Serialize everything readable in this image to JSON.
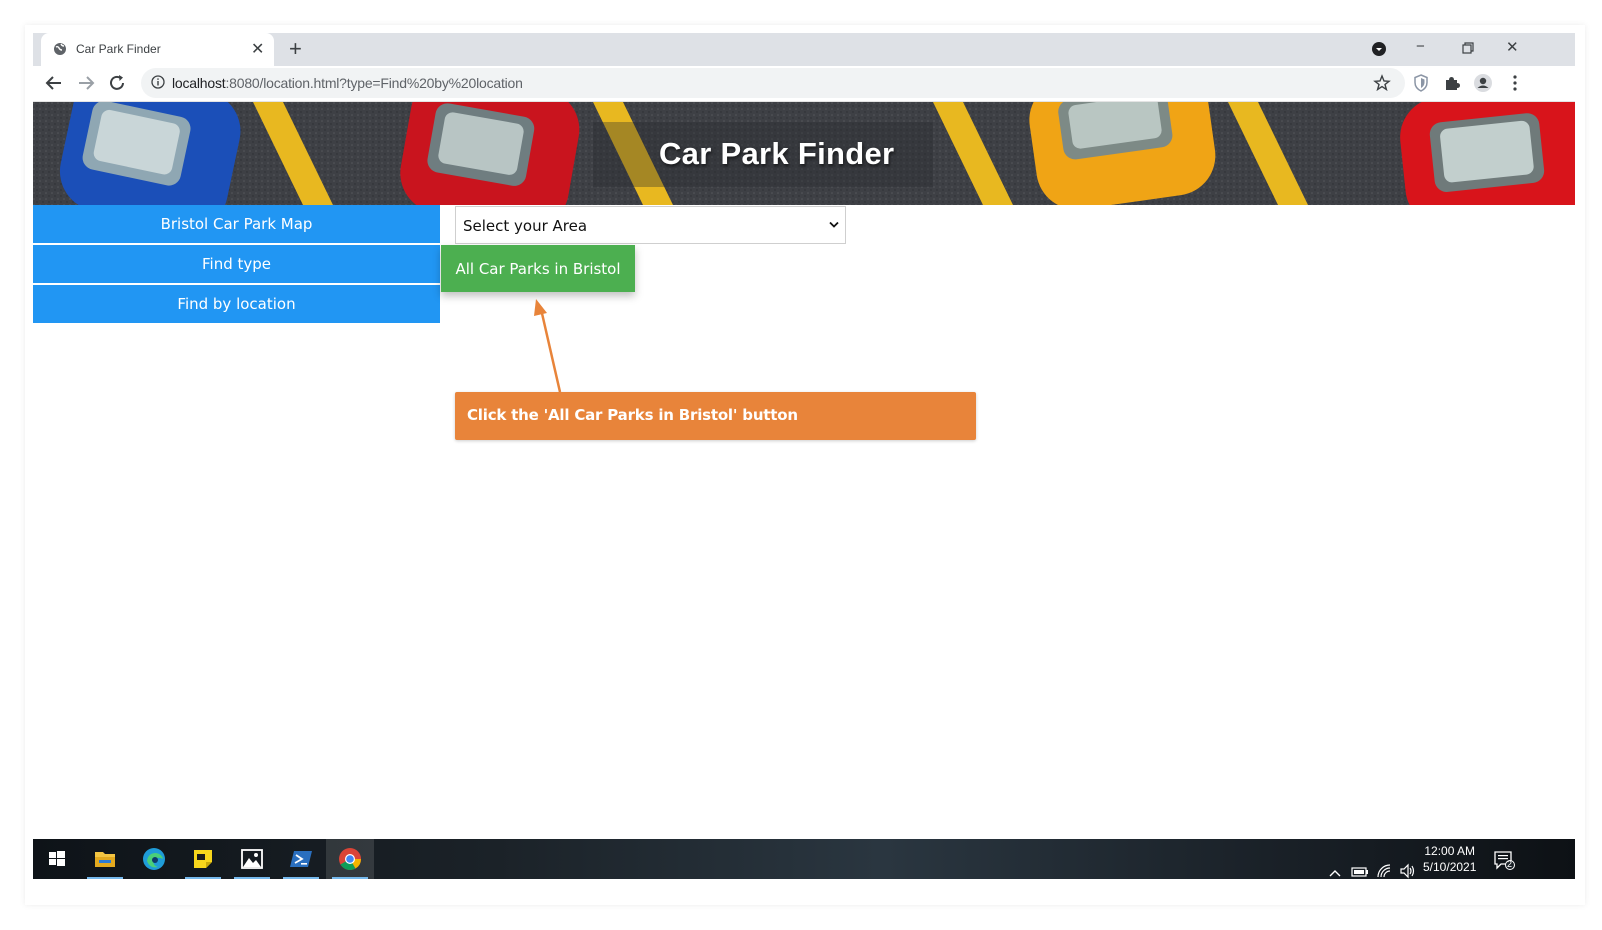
{
  "browser": {
    "tab_title": "Car Park Finder",
    "url_host": "localhost",
    "url_rest": ":8080/location.html?type=Find%20by%20location"
  },
  "page": {
    "banner_title": "Car Park Finder",
    "sidebar": [
      {
        "label": "Bristol Car Park Map"
      },
      {
        "label": "Find type"
      },
      {
        "label": "Find by location"
      }
    ],
    "area_select": {
      "selected": "Select your Area"
    },
    "all_car_parks_button": "All Car Parks in Bristol"
  },
  "annotation": {
    "callout_text": "Click the 'All Car Parks in Bristol' button",
    "callout_color": "#e8843a"
  },
  "taskbar": {
    "apps": [
      "start-icon",
      "file-explorer-icon",
      "edge-icon",
      "sticky-notes-icon",
      "photos-icon",
      "powershell-icon",
      "chrome-icon"
    ],
    "time": "12:00 AM",
    "date": "5/10/2021",
    "notification_count": "2"
  },
  "colors": {
    "sidebar_blue": "#2196f3",
    "green_button": "#4caf50"
  }
}
